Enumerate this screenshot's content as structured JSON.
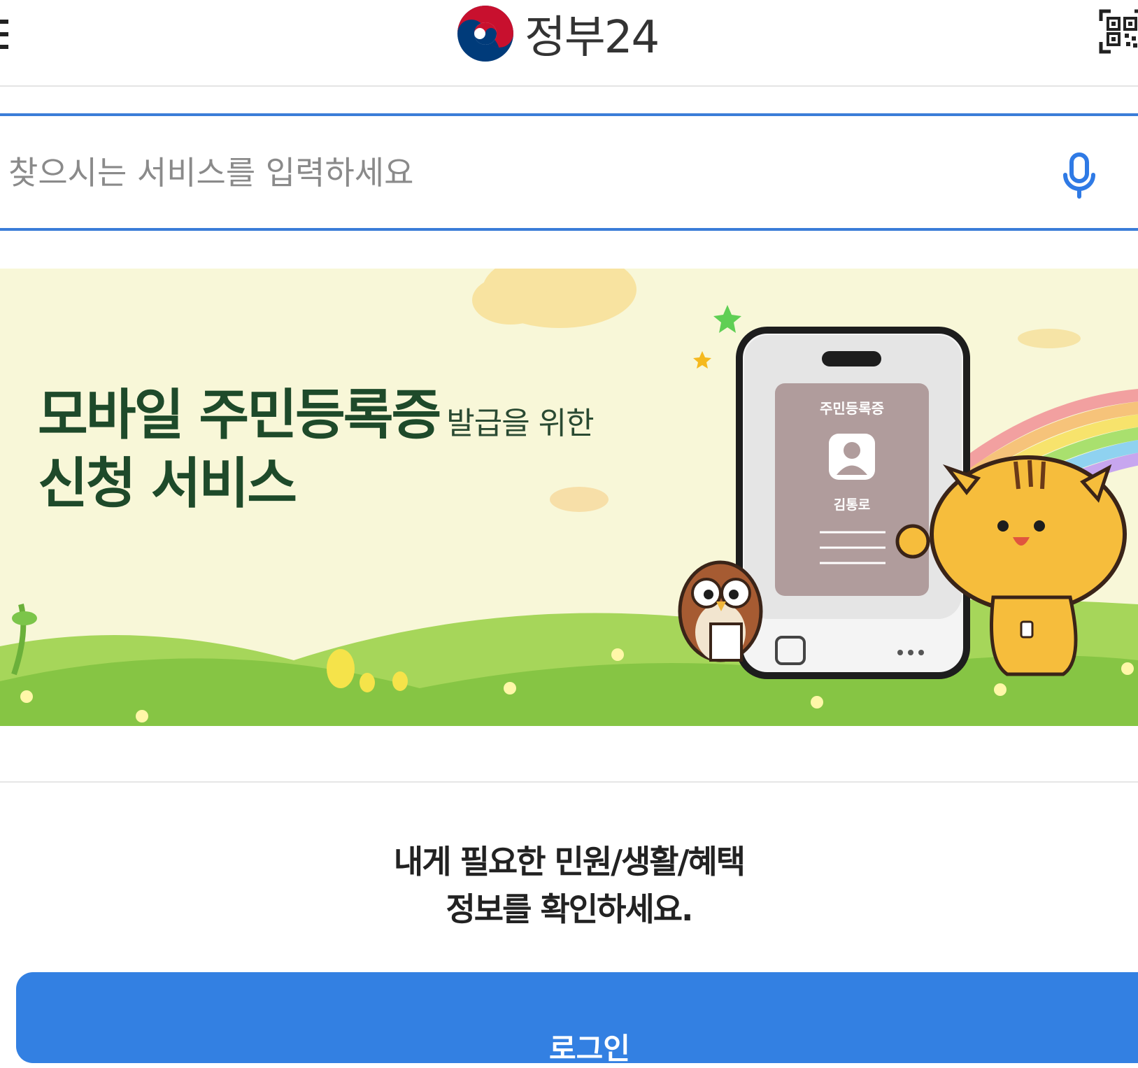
{
  "header": {
    "logo_text": "정부24"
  },
  "search": {
    "placeholder": "찾으시는 서비스를 입력하세요"
  },
  "banner": {
    "title_line1": "모바일 주민등록증",
    "title_line1_suffix": "발급을 위한",
    "title_line2": "신청 서비스",
    "card_title": "주민등록증",
    "card_name": "김통로"
  },
  "info": {
    "line1": "내게 필요한 민원/생활/혜택",
    "line2": "정보를 확인하세요."
  },
  "login": {
    "label": "로그인"
  },
  "colors": {
    "accent": "#3b7dd8",
    "button": "#3380e2",
    "banner_bg": "#f8f7d8",
    "banner_title": "#1e4a2a"
  },
  "icons": [
    "menu-icon",
    "government-logo-icon",
    "qr-code-icon",
    "microphone-icon"
  ]
}
